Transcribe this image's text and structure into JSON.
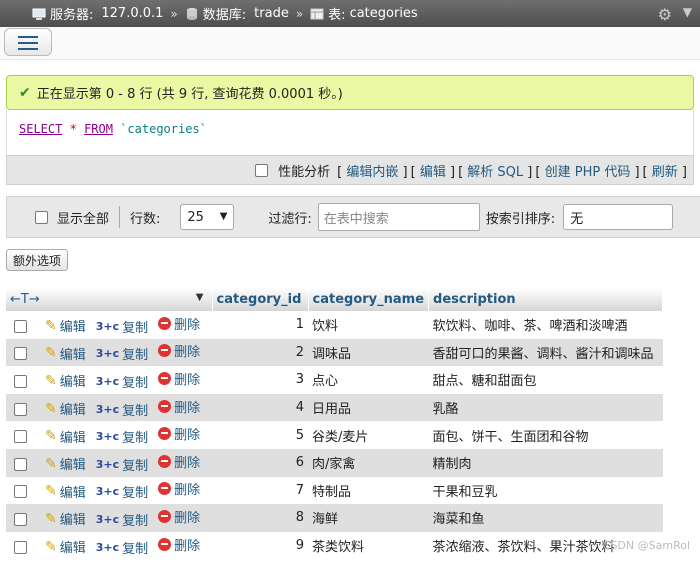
{
  "breadcrumb": {
    "server_label": "服务器:",
    "server_value": "127.0.0.1",
    "db_label": "数据库:",
    "db_value": "trade",
    "table_label": "表:",
    "table_value": "categories",
    "separator": "»"
  },
  "message": {
    "text": "正在显示第 0 - 8 行 (共 9 行, 查询花费 0.0001 秒。)"
  },
  "sql": {
    "select": "SELECT",
    "star": "*",
    "from": "FROM",
    "table": "`categories`"
  },
  "sql_actions": {
    "profiling": "性能分析",
    "items": [
      "编辑内嵌",
      "编辑",
      "解析 SQL",
      "创建 PHP 代码",
      "刷新"
    ]
  },
  "navbar": {
    "show_all": "显示全部",
    "rows_label": "行数:",
    "rows_value": "25",
    "filter_label": "过滤行:",
    "filter_placeholder": "在表中搜索",
    "sort_label": "按索引排序:",
    "sort_value": "无"
  },
  "extra_options": "额外选项",
  "table": {
    "columns": [
      "category_id",
      "category_name",
      "description"
    ],
    "actions": {
      "edit": "编辑",
      "copy": "复制",
      "delete": "删除"
    },
    "rows": [
      {
        "id": "1",
        "name": "饮料",
        "desc": "软饮料、咖啡、茶、啤酒和淡啤酒"
      },
      {
        "id": "2",
        "name": "调味品",
        "desc": "香甜可口的果酱、调料、酱汁和调味品"
      },
      {
        "id": "3",
        "name": "点心",
        "desc": "甜点、糖和甜面包"
      },
      {
        "id": "4",
        "name": "日用品",
        "desc": "乳酪"
      },
      {
        "id": "5",
        "name": "谷类/麦片",
        "desc": "面包、饼干、生面团和谷物"
      },
      {
        "id": "6",
        "name": "肉/家禽",
        "desc": "精制肉"
      },
      {
        "id": "7",
        "name": "特制品",
        "desc": "干果和豆乳"
      },
      {
        "id": "8",
        "name": "海鲜",
        "desc": "海菜和鱼"
      },
      {
        "id": "9",
        "name": "茶类饮料",
        "desc": "茶浓缩液、茶饮料、果汁茶饮料"
      }
    ]
  },
  "watermark": "CSDN @SamRol",
  "colors": {
    "link": "#235a81",
    "success_bg": "#ebf8a4",
    "topbar": "#5a5a5a"
  }
}
